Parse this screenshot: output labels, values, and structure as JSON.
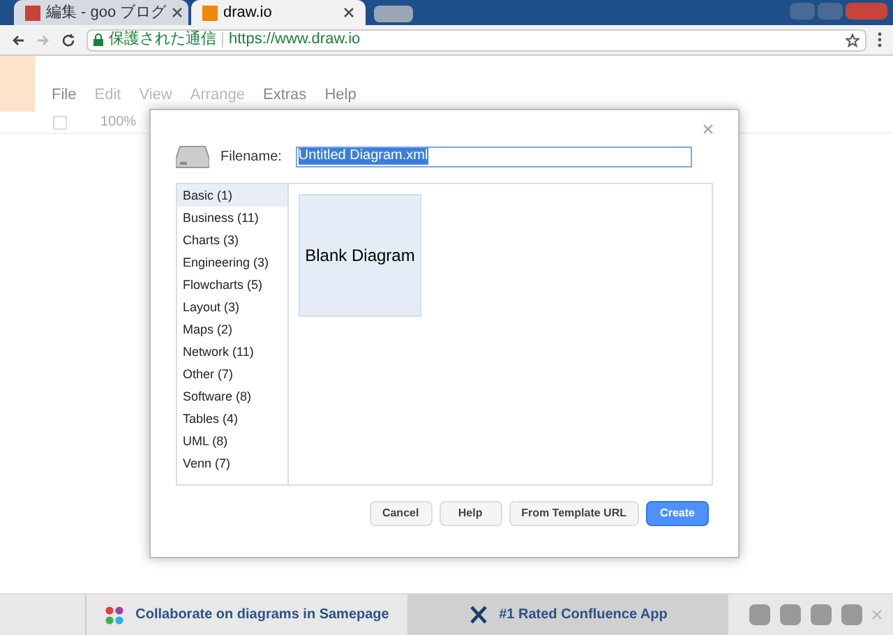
{
  "browser": {
    "tabs": [
      {
        "title": "編集 - goo ブログ",
        "selected": false
      },
      {
        "title": "draw.io",
        "selected": true
      }
    ],
    "security_label": "保護された通信",
    "url": "https://www.draw.io"
  },
  "app": {
    "menu": [
      {
        "label": "File",
        "disabled": false
      },
      {
        "label": "Edit",
        "disabled": true
      },
      {
        "label": "View",
        "disabled": true
      },
      {
        "label": "Arrange",
        "disabled": true
      },
      {
        "label": "Extras",
        "disabled": false
      },
      {
        "label": "Help",
        "disabled": false
      }
    ],
    "zoom": "100%"
  },
  "dialog": {
    "filename_label": "Filename:",
    "filename": "Untitled Diagram.xml",
    "categories": [
      {
        "label": "Basic (1)",
        "selected": true
      },
      {
        "label": "Business (11)",
        "selected": false
      },
      {
        "label": "Charts (3)",
        "selected": false
      },
      {
        "label": "Engineering (3)",
        "selected": false
      },
      {
        "label": "Flowcharts (5)",
        "selected": false
      },
      {
        "label": "Layout (3)",
        "selected": false
      },
      {
        "label": "Maps (2)",
        "selected": false
      },
      {
        "label": "Network (11)",
        "selected": false
      },
      {
        "label": "Other (7)",
        "selected": false
      },
      {
        "label": "Software (8)",
        "selected": false
      },
      {
        "label": "Tables (4)",
        "selected": false
      },
      {
        "label": "UML (8)",
        "selected": false
      },
      {
        "label": "Venn (7)",
        "selected": false
      }
    ],
    "templates": [
      {
        "label": "Blank Diagram"
      }
    ],
    "buttons": [
      {
        "label": "Cancel",
        "kind": "secondary"
      },
      {
        "label": "Help",
        "kind": "secondary"
      },
      {
        "label": "From Template URL",
        "kind": "secondary"
      },
      {
        "label": "Create",
        "kind": "primary"
      }
    ]
  },
  "footer": {
    "links": [
      {
        "label": "Collaborate on diagrams in Samepage",
        "selected": false
      },
      {
        "label": "#1 Rated Confluence App",
        "selected": true
      }
    ]
  }
}
